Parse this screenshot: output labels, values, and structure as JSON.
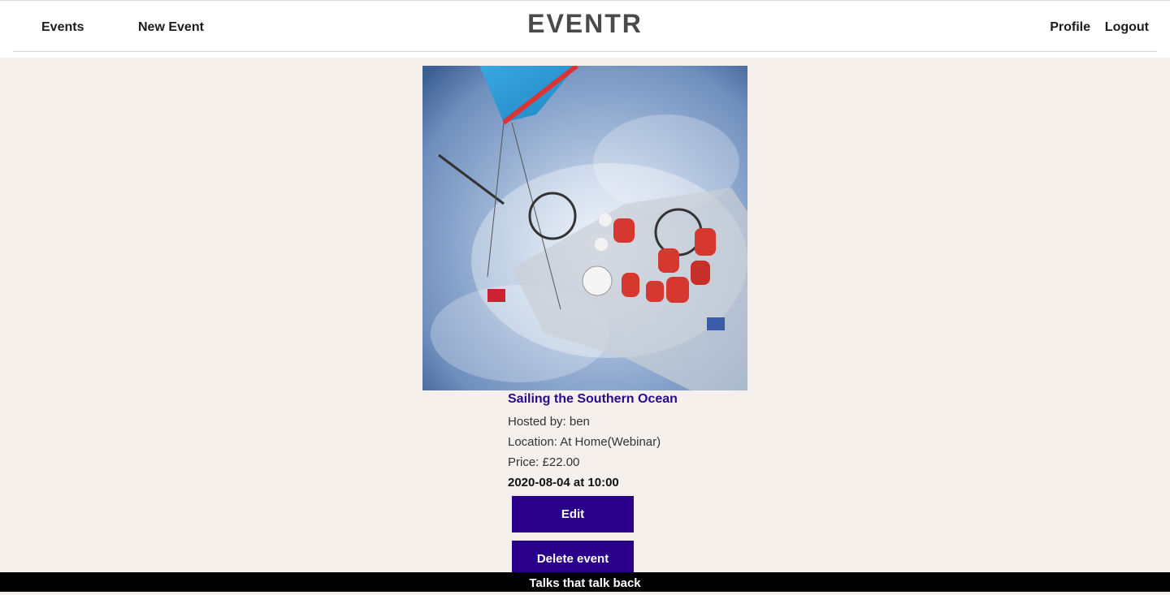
{
  "nav": {
    "events_label": "Events",
    "new_event_label": "New Event",
    "brand": "EVENTR",
    "profile_label": "Profile",
    "logout_label": "Logout"
  },
  "event": {
    "image_alt": "Aerial photo of a racing yacht crew in rough sea",
    "title": "Sailing the Southern Ocean",
    "hosted_by": "Hosted by: ben",
    "location": "Location: At Home(Webinar)",
    "price": "Price: £22.00",
    "datetime": "2020-08-04 at 10:00"
  },
  "actions": {
    "edit_label": "Edit",
    "delete_label": "Delete event"
  },
  "footer": {
    "tagline": "Talks that talk back"
  },
  "colors": {
    "accent": "#2a008a",
    "title": "#2a0a8c",
    "page_background": "#f5f0ec",
    "footer_background": "#000000"
  }
}
